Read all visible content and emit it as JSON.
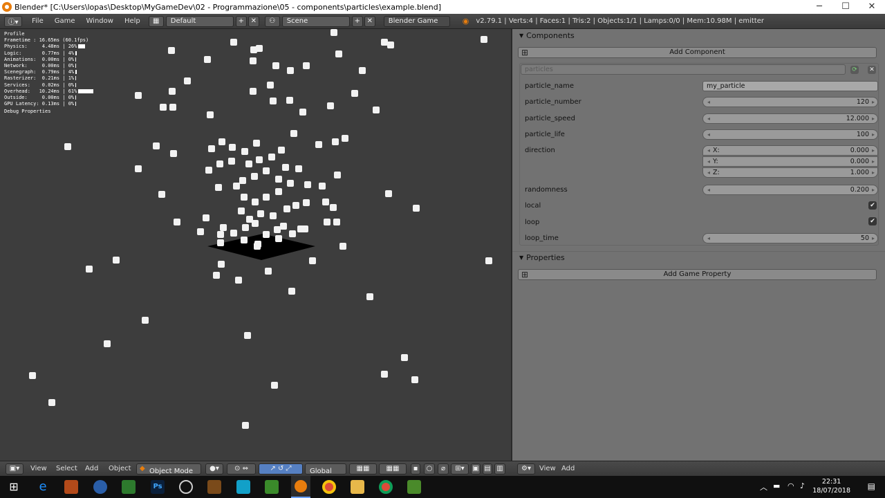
{
  "window": {
    "title": "Blender* [C:\\Users\\lopas\\Desktop\\MyGameDev\\02 - Programmazione\\05 - components\\particles\\example.blend]",
    "controls": [
      "─",
      "☐",
      "✕"
    ]
  },
  "menubar": {
    "menus": [
      "File",
      "Game",
      "Window",
      "Help"
    ],
    "layout": "Default",
    "scene": "Scene",
    "engine": "Blender Game",
    "stats": "v2.79.1 | Verts:4 | Faces:1 | Tris:2 | Objects:1/1 | Lamps:0/0 | Mem:10.98M | emitter"
  },
  "profile": {
    "title": "Profile",
    "rows": [
      {
        "label": "Frametime : 16.65ms (60.1fps)",
        "percent": null
      },
      {
        "label": "Physics:     4.48ms | 26%",
        "percent": 26
      },
      {
        "label": "Logic:       0.77ms | 4%",
        "percent": 4
      },
      {
        "label": "Animations:  0.00ms | 0%",
        "percent": 0
      },
      {
        "label": "Network:     0.00ms | 0%",
        "percent": 0
      },
      {
        "label": "Scenegraph:  0.79ms | 4%",
        "percent": 4
      },
      {
        "label": "Rasterizer:  0.21ms | 1%",
        "percent": 1
      },
      {
        "label": "Services:    0.02ms | 0%",
        "percent": 0
      },
      {
        "label": "Overhead:   10.24ms | 61%",
        "percent": 61
      },
      {
        "label": "Outside:     0.00ms | 0%",
        "percent": 0
      },
      {
        "label": "GPU Latency: 0.13ms | 0%",
        "percent": 0
      }
    ],
    "footer": "Debug Properties"
  },
  "components": {
    "header": "Components",
    "add_label": "Add Component",
    "name": "particles",
    "properties": {
      "particle_name": {
        "label": "particle_name",
        "value": "my_particle"
      },
      "particle_number": {
        "label": "particle_number",
        "value": "120"
      },
      "particle_speed": {
        "label": "particle_speed",
        "value": "12.000"
      },
      "particle_life": {
        "label": "particle_life",
        "value": "100"
      },
      "direction": {
        "label": "direction",
        "x_label": "X:",
        "x": "0.000",
        "y_label": "Y:",
        "y": "0.000",
        "z_label": "Z:",
        "z": "1.000"
      },
      "randomness": {
        "label": "randomness",
        "value": "0.200"
      },
      "local": {
        "label": "local",
        "checked": true
      },
      "loop": {
        "label": "loop",
        "checked": true
      },
      "loop_time": {
        "label": "loop_time",
        "value": "50"
      }
    }
  },
  "game_properties": {
    "header": "Properties",
    "add_label": "Add Game Property"
  },
  "view3d_header": {
    "menus": [
      "View",
      "Select",
      "Add",
      "Object"
    ],
    "mode": "Object Mode",
    "orientation": "Global"
  },
  "properties_header": {
    "menus": [
      "View",
      "Add"
    ]
  },
  "taskbar": {
    "time": "22:31",
    "date": "18/07/2018"
  },
  "colors": {
    "viewport_bg": "#3d3d3d",
    "panel_bg": "#727272",
    "particle": "#f2f2f2",
    "taskbar": "#101010"
  }
}
